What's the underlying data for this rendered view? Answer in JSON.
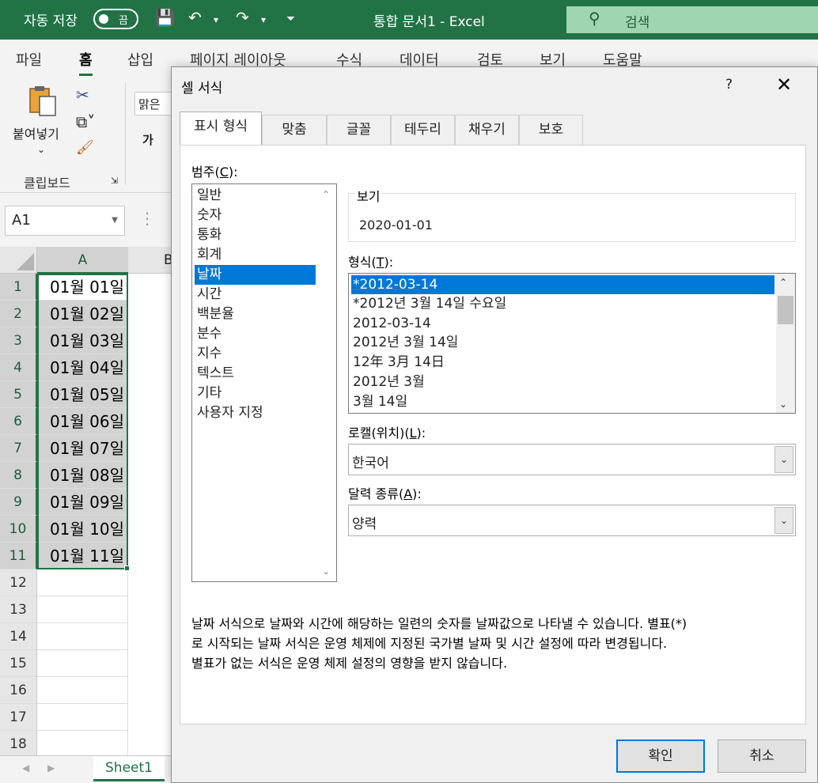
{
  "titlebar": {
    "autosave_label": "자동 저장",
    "toggle_state": "끔",
    "doc_title": "통합 문서1  -  Excel",
    "search_placeholder": "검색",
    "accent_color": "#217346"
  },
  "ribbon": {
    "tabs": [
      "파일",
      "홈",
      "삽입",
      "페이지 레이아웃",
      "수식",
      "데이터",
      "검토",
      "보기",
      "도움말"
    ],
    "active_tab": "홈",
    "paste_label": "붙여넣기",
    "clipboard_group": "클립보드",
    "font_name": "맑은",
    "bold_label": "가"
  },
  "formula_bar": {
    "name_box": "A1"
  },
  "grid": {
    "col_a": "A",
    "col_b": "B",
    "rows": [
      "1",
      "2",
      "3",
      "4",
      "5",
      "6",
      "7",
      "8",
      "9",
      "10",
      "11",
      "12",
      "13",
      "14",
      "15",
      "16",
      "17",
      "18"
    ],
    "cells": [
      "01월 01일",
      "01월 02일",
      "01월 03일",
      "01월 04일",
      "01월 05일",
      "01월 06일",
      "01월 07일",
      "01월 08일",
      "01월 09일",
      "01월 10일",
      "01월 11일"
    ],
    "sheet_tab": "Sheet1"
  },
  "dialog": {
    "title": "셀 서식",
    "help": "?",
    "tabs": [
      "표시 형식",
      "맞춤",
      "글꼴",
      "테두리",
      "채우기",
      "보호"
    ],
    "active_tab": "표시 형식",
    "category_label": "범주",
    "category_key": "C",
    "categories": [
      "일반",
      "숫자",
      "통화",
      "회계",
      "날짜",
      "시간",
      "백분율",
      "분수",
      "지수",
      "텍스트",
      "기타",
      "사용자 지정"
    ],
    "selected_category": "날짜",
    "sample_label": "보기",
    "sample_value": "2020-01-01",
    "type_label": "형식",
    "type_key": "T",
    "formats": [
      "*2012-03-14",
      "*2012년 3월 14일 수요일",
      "2012-03-14",
      "2012년 3월 14일",
      "12年 3月 14日",
      "2012년 3월",
      "3월 14일"
    ],
    "selected_format": "*2012-03-14",
    "locale_label": "로캘(위치)",
    "locale_key": "L",
    "locale_value": "한국어",
    "calendar_label": "달력 종류",
    "calendar_key": "A",
    "calendar_value": "양력",
    "description_lines": [
      "날짜 서식으로 날짜와 시간에 해당하는 일련의 숫자를 날짜값으로 나타낼 수 있습니다. 별표(*)",
      "로 시작되는 날짜 서식은 운영 체제에 지정된 국가별 날짜 및 시간 설정에 따라 변경됩니다.",
      "별표가 없는 서식은 운영 체제 설정의 영향을 받지 않습니다."
    ],
    "ok": "확인",
    "cancel": "취소"
  }
}
